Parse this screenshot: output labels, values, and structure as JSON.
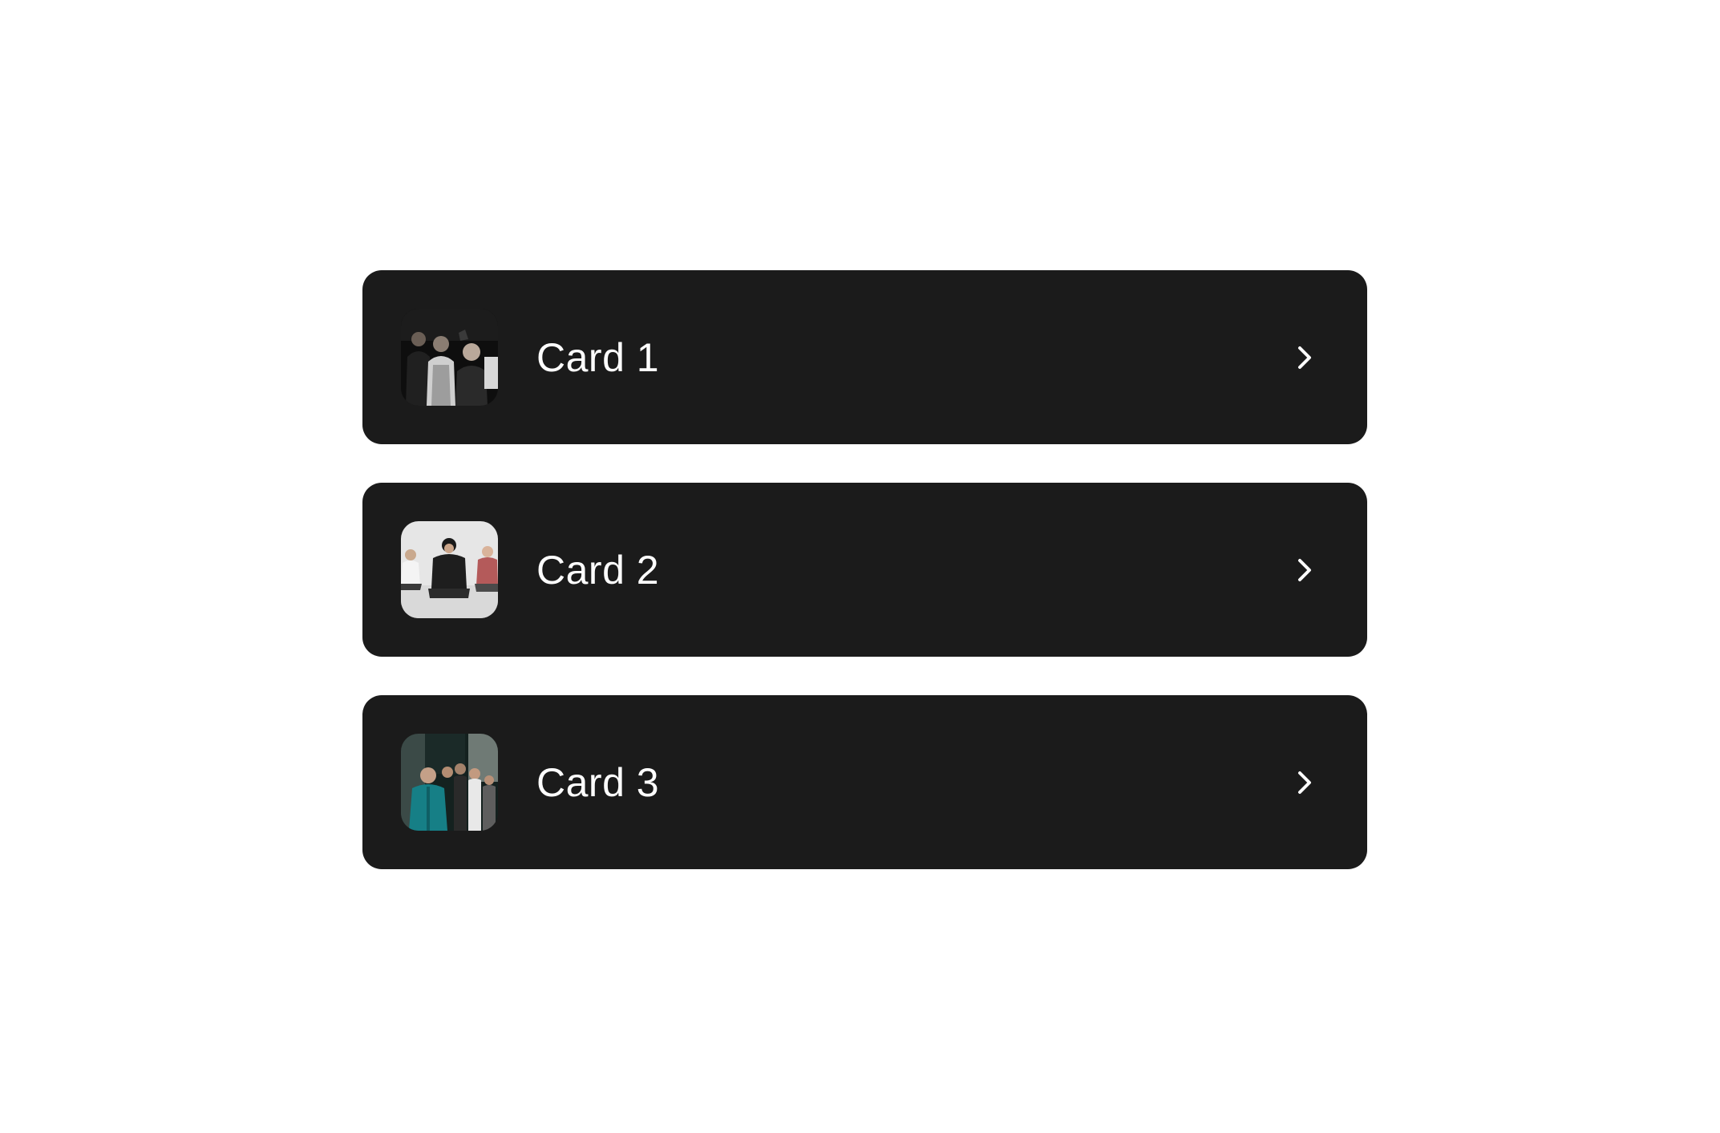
{
  "cards": [
    {
      "title": "Card 1",
      "thumbnail": "band-photo-dark",
      "chevron": "chevron-right-icon"
    },
    {
      "title": "Card 2",
      "thumbnail": "band-photo-light",
      "chevron": "chevron-right-icon"
    },
    {
      "title": "Card 3",
      "thumbnail": "band-photo-teal",
      "chevron": "chevron-right-icon"
    }
  ],
  "colors": {
    "page_background": "#ffffff",
    "card_background": "#1b1b1b",
    "text": "#ffffff",
    "chevron": "#ffffff"
  }
}
